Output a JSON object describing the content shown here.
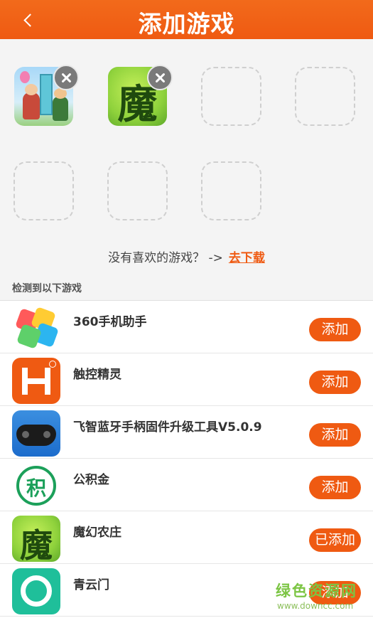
{
  "header": {
    "title": "添加游戏"
  },
  "added_slots": [
    {
      "game": "kairosoft",
      "icon": "kairosoft-icon"
    },
    {
      "game": "魔幻农庄",
      "icon": "mo-icon",
      "glyph": "魔"
    }
  ],
  "prompt": {
    "text": "没有喜欢的游戏？ ->",
    "link": "去下载"
  },
  "section_label": "检测到以下游戏",
  "apps": [
    {
      "name": "360手机助手",
      "button": "添加",
      "icon": "360-icon"
    },
    {
      "name": "触控精灵",
      "button": "添加",
      "icon": "touch-h-icon"
    },
    {
      "name": "飞智蓝牙手柄固件升级工具V5.0.9",
      "button": "添加",
      "icon": "gamepad-icon"
    },
    {
      "name": "公积金",
      "button": "添加",
      "icon": "gongjijin-icon",
      "glyph": "积"
    },
    {
      "name": "魔幻农庄",
      "button": "已添加",
      "icon": "mo-icon",
      "glyph": "魔"
    },
    {
      "name": "青云门",
      "button": "添加",
      "icon": "qingyunmen-icon"
    }
  ],
  "watermark": {
    "line1": "绿色资源网",
    "line2": "www.downcc.com"
  },
  "colors": {
    "accent": "#ef5a12",
    "background": "#f4f4f4"
  }
}
